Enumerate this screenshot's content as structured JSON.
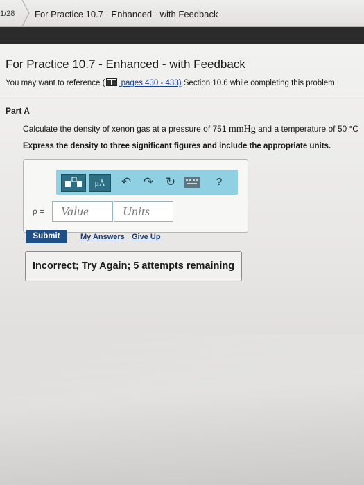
{
  "topbar": {
    "count": "1/28",
    "title": "For Practice 10.7 - Enhanced - with Feedback"
  },
  "page": {
    "title": "For Practice 10.7 - Enhanced - with Feedback",
    "reference_prefix": "You may want to reference (",
    "reference_link": " pages 430 - 433)",
    "reference_suffix": " Section 10.6 while completing this problem."
  },
  "part": {
    "label": "Part A",
    "question_start": "Calculate the density of xenon gas at a pressure of 751 ",
    "question_unit": "mmHg",
    "question_end": " and a temperature of 50 °C",
    "instruction": "Express the density to three significant figures and include the appropriate units."
  },
  "answer": {
    "toolbar": {
      "mu_label": "μÅ",
      "undo_icon": "↶",
      "redo_icon": "↷",
      "reset_icon": "↻",
      "help_label": "?"
    },
    "variable_label": "ρ =",
    "value_placeholder": "Value",
    "units_placeholder": "Units"
  },
  "actions": {
    "submit": "Submit",
    "my_answers": "My Answers",
    "give_up": "Give Up"
  },
  "feedback": {
    "message": "Incorrect; Try Again; 5 attempts remaining"
  },
  "colors": {
    "toolbar_bg": "#8fd0e2",
    "submit_bg": "#1e4f86",
    "link": "#1a3f8e"
  }
}
